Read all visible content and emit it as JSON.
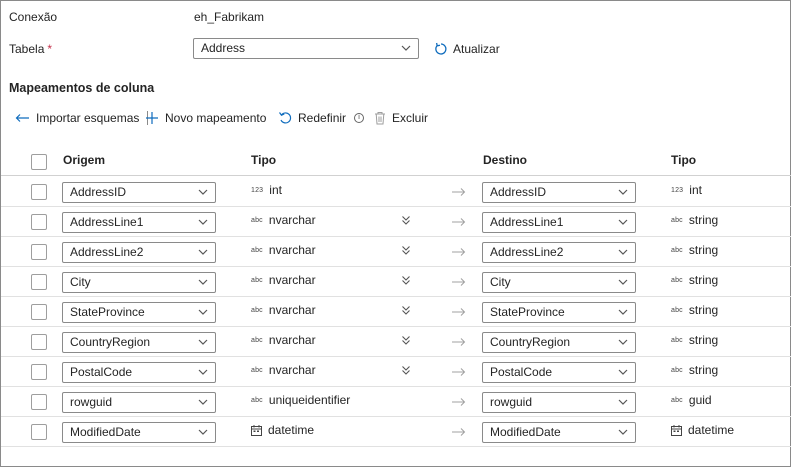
{
  "connection": {
    "label": "Conexão",
    "value": "eh_Fabrikam"
  },
  "table": {
    "label": "Tabela",
    "required_mark": "*",
    "selected": "Address"
  },
  "refresh_label": "Atualizar",
  "mappings": {
    "title": "Mapeamentos de coluna",
    "toolbar": {
      "import_label": "Importar esquemas",
      "new_label": "Novo mapeamento",
      "reset_label": "Redefinir",
      "reset_info": "i",
      "delete_label": "Excluir"
    },
    "headers": {
      "source": "Origem",
      "source_type": "Tipo",
      "destination": "Destino",
      "dest_type": "Tipo"
    },
    "rows": [
      {
        "source": "AddressID",
        "src_icon": "123",
        "src_type": "int",
        "dest": "AddressID",
        "dst_icon": "123",
        "dst_type": "int",
        "expand": false
      },
      {
        "source": "AddressLine1",
        "src_icon": "abc",
        "src_type": "nvarchar",
        "dest": "AddressLine1",
        "dst_icon": "abc",
        "dst_type": "string",
        "expand": true
      },
      {
        "source": "AddressLine2",
        "src_icon": "abc",
        "src_type": "nvarchar",
        "dest": "AddressLine2",
        "dst_icon": "abc",
        "dst_type": "string",
        "expand": true
      },
      {
        "source": "City",
        "src_icon": "abc",
        "src_type": "nvarchar",
        "dest": "City",
        "dst_icon": "abc",
        "dst_type": "string",
        "expand": true
      },
      {
        "source": "StateProvince",
        "src_icon": "abc",
        "src_type": "nvarchar",
        "dest": "StateProvince",
        "dst_icon": "abc",
        "dst_type": "string",
        "expand": true
      },
      {
        "source": "CountryRegion",
        "src_icon": "abc",
        "src_type": "nvarchar",
        "dest": "CountryRegion",
        "dst_icon": "abc",
        "dst_type": "string",
        "expand": true
      },
      {
        "source": "PostalCode",
        "src_icon": "abc",
        "src_type": "nvarchar",
        "dest": "PostalCode",
        "dst_icon": "abc",
        "dst_type": "string",
        "expand": true
      },
      {
        "source": "rowguid",
        "src_icon": "abc",
        "src_type": "uniqueidentifier",
        "dest": "rowguid",
        "dst_icon": "abc",
        "dst_type": "guid",
        "expand": false
      },
      {
        "source": "ModifiedDate",
        "src_icon": "calendar-icon",
        "src_type": "datetime",
        "dest": "ModifiedDate",
        "dst_icon": "calendar-icon",
        "dst_type": "datetime",
        "expand": false
      }
    ]
  },
  "colors": {
    "accent": "#0f6cbd",
    "border": "#8a8a8a",
    "text": "#242424"
  }
}
